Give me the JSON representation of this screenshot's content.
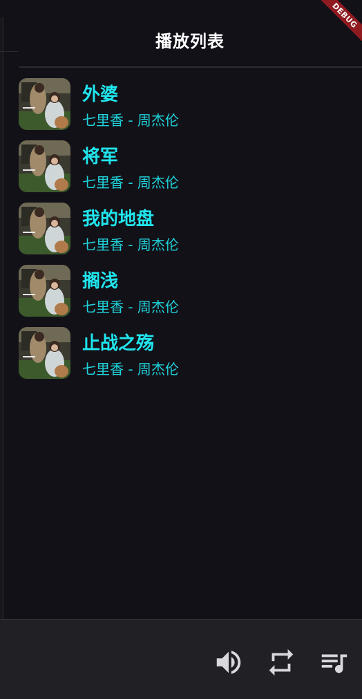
{
  "playlist": {
    "title": "播放列表",
    "songs": [
      {
        "title": "外婆",
        "subtitle": "七里香 - 周杰伦"
      },
      {
        "title": "将军",
        "subtitle": "七里香 - 周杰伦"
      },
      {
        "title": "我的地盘",
        "subtitle": "七里香 - 周杰伦"
      },
      {
        "title": "搁浅",
        "subtitle": "七里香 - 周杰伦"
      },
      {
        "title": "止战之殇",
        "subtitle": "七里香 - 周杰伦"
      }
    ]
  },
  "controls": {
    "icons": [
      "volume-icon",
      "repeat-icon",
      "playlist-icon"
    ],
    "icon_color": "#d8d8de"
  },
  "debug_banner": {
    "label": "DEBUG",
    "color": "#8f1a1f"
  },
  "colors": {
    "background": "#131118",
    "accent": "#20e6ee",
    "bottom_bar": "#212025"
  }
}
